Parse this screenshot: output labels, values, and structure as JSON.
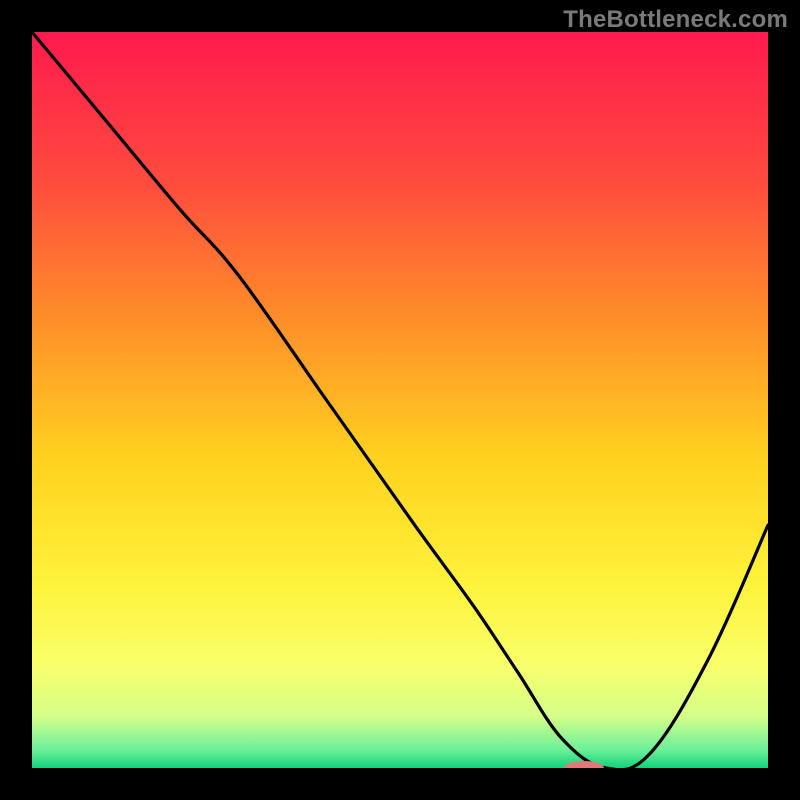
{
  "watermark": "TheBottleneck.com",
  "chart_data": {
    "type": "line",
    "title": "",
    "xlabel": "",
    "ylabel": "",
    "xlim": [
      0,
      100
    ],
    "ylim": [
      0,
      100
    ],
    "gradient_stops": [
      {
        "offset": 0.0,
        "color": "#ff1a4d"
      },
      {
        "offset": 0.2,
        "color": "#ff4a3e"
      },
      {
        "offset": 0.38,
        "color": "#ff8a2a"
      },
      {
        "offset": 0.58,
        "color": "#ffd21f"
      },
      {
        "offset": 0.75,
        "color": "#fff23a"
      },
      {
        "offset": 0.86,
        "color": "#f9ff6b"
      },
      {
        "offset": 0.93,
        "color": "#d4ff88"
      },
      {
        "offset": 0.975,
        "color": "#6cf09a"
      },
      {
        "offset": 1.0,
        "color": "#14d17a"
      }
    ],
    "series": [
      {
        "name": "bottleneck-curve",
        "x": [
          0,
          10,
          20,
          28,
          40,
          52,
          60,
          66,
          72,
          78,
          84,
          92,
          100
        ],
        "y": [
          100,
          88,
          76,
          67,
          50,
          33,
          22,
          13,
          4,
          0,
          2,
          15,
          33
        ]
      }
    ],
    "marker": {
      "name": "optimal-point",
      "x": 75,
      "y": 0,
      "color": "#e07a7a",
      "rx": 20,
      "ry": 7
    }
  }
}
